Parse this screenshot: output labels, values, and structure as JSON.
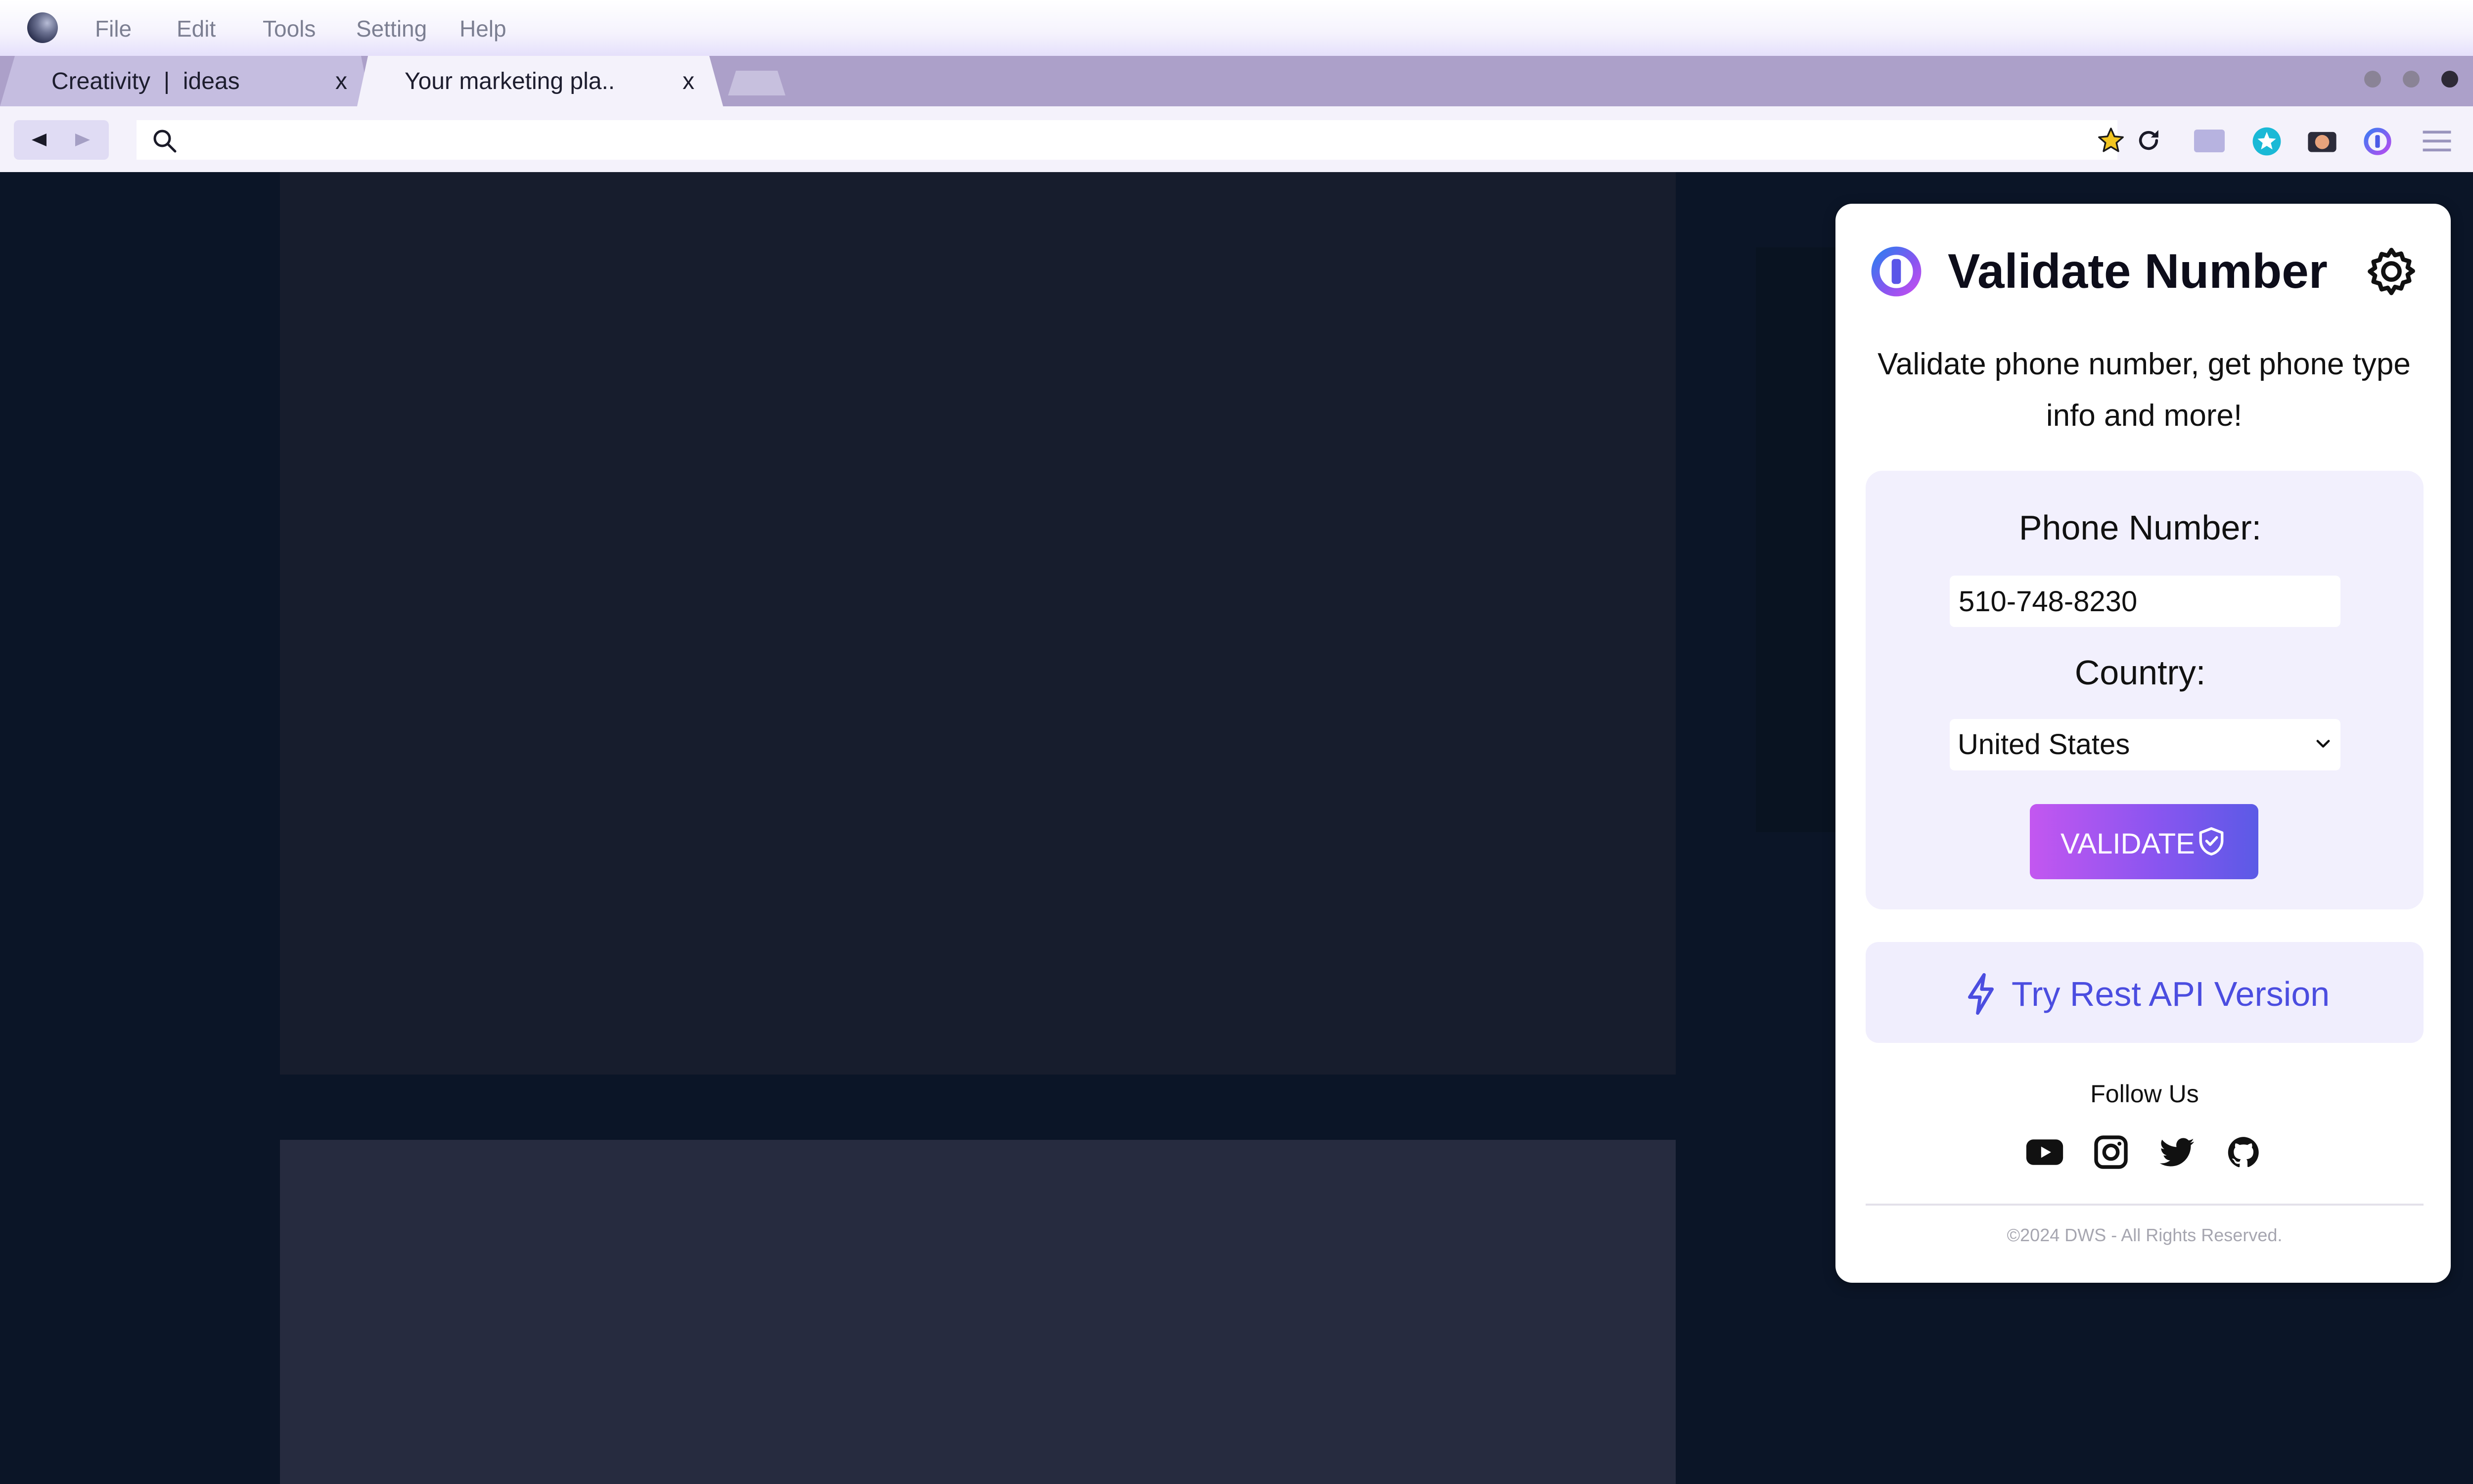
{
  "menu": {
    "items": [
      "File",
      "Edit",
      "Tools",
      "Setting",
      "Help"
    ]
  },
  "tabs": [
    {
      "label": "Creativity  |  ideas",
      "close": "x",
      "active": false
    },
    {
      "label": "Your marketing pla..",
      "close": "x",
      "active": true
    }
  ],
  "address_bar": {
    "url": "",
    "search_icon": "search-icon"
  },
  "toolbar_icons": [
    "star-icon",
    "reload-icon",
    "screen-icon",
    "star-badge-icon",
    "camera-icon",
    "validate-number-extension-icon",
    "hamburger-menu-icon"
  ],
  "popup": {
    "title": "Validate Number",
    "description": "Validate phone number, get phone type info and more!",
    "phone_label": "Phone Number:",
    "phone_value": "510-748-8230",
    "country_label": "Country:",
    "country_value": "United States",
    "validate_label": "VALIDATE",
    "api_label": "Try Rest API Version",
    "follow_label": "Follow Us",
    "social_icons": [
      "youtube-icon",
      "instagram-icon",
      "twitter-icon",
      "github-icon"
    ],
    "copyright": "©2024 DWS - All Rights Reserved.",
    "colors": {
      "accent": "#4b4de0",
      "button_gradient_start": "#c357f0",
      "button_gradient_end": "#5b5ae6",
      "card_bg": "#f2f0fd"
    }
  },
  "page_colors": {
    "background": "#0b1527",
    "panel_top": "#171d2d",
    "panel_bottom": "#262b3f"
  }
}
